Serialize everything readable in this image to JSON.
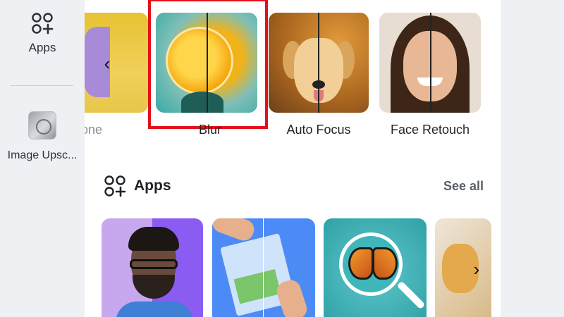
{
  "sidebar": {
    "items": [
      {
        "label": "Apps",
        "icon": "apps-grid-icon"
      },
      {
        "label": "Image Upsc...",
        "icon": "image-upscaler-icon"
      }
    ]
  },
  "effects": {
    "items": [
      {
        "label": "one",
        "icon": "clone-thumbnail"
      },
      {
        "label": "Blur",
        "icon": "blur-thumbnail",
        "highlighted": true
      },
      {
        "label": "Auto Focus",
        "icon": "auto-focus-thumbnail"
      },
      {
        "label": "Face Retouch",
        "icon": "face-retouch-thumbnail"
      }
    ],
    "prev_icon": "chevron-left-icon",
    "highlight_color": "#e3101b"
  },
  "apps_section": {
    "title": "Apps",
    "see_all": "See all",
    "icon": "apps-grid-icon",
    "next_icon": "chevron-right-icon"
  },
  "colors": {
    "panel_bg": "#ffffff",
    "rail_bg": "#eef0f3",
    "text": "#1f2328",
    "muted": "#5b6068"
  }
}
